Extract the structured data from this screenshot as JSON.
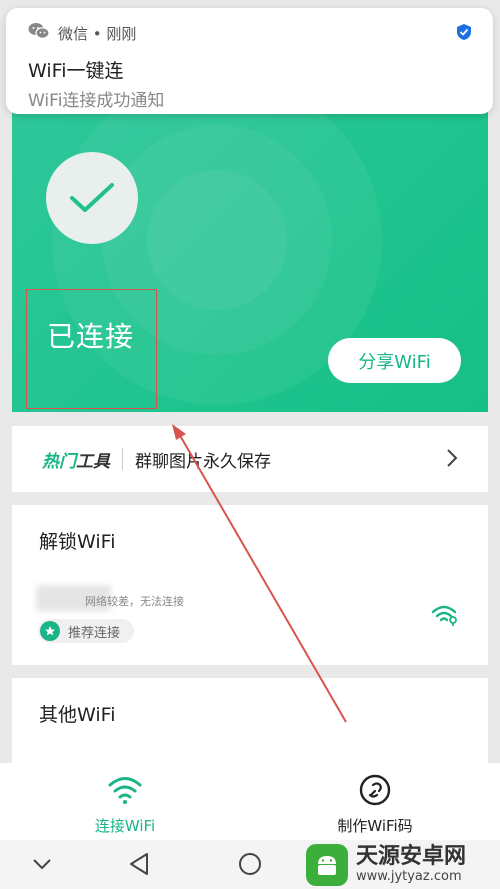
{
  "notification": {
    "app": "微信 • 刚刚",
    "title": "WiFi一键连",
    "body": "WiFi连接成功通知"
  },
  "hero": {
    "status": "已连接",
    "share_label": "分享WiFi"
  },
  "tools": {
    "hot": "热门",
    "tool": "工具",
    "text": "群聊图片永久保存"
  },
  "unlock": {
    "title": "解锁WiFi",
    "weak_text": "网络较差，无法连接",
    "recommend": "推荐连接"
  },
  "other": {
    "title": "其他WiFi"
  },
  "bottom_nav": {
    "connect": "连接WiFi",
    "make_code": "制作WiFi码"
  },
  "watermark": {
    "title": "天源安卓网",
    "url": "www.jytyaz.com"
  },
  "colors": {
    "accent": "#1ab587",
    "annotation": "#d9534f"
  }
}
